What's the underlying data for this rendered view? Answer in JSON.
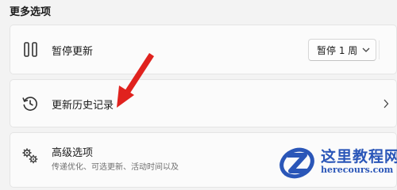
{
  "section": {
    "title": "更多选项"
  },
  "pause_card": {
    "label": "暂停更新",
    "icon": "pause-icon",
    "dropdown_value": "暂停 1 周"
  },
  "history_card": {
    "label": "更新历史记录",
    "icon": "history-icon"
  },
  "advanced_card": {
    "label": "高级选项",
    "description": "传递优化、可选更新、活动时间以及",
    "icon": "gears-icon"
  },
  "annotation": {
    "arrow_color": "#e0221e"
  },
  "watermark": {
    "title": "这里教程网",
    "url": "herecours.com"
  }
}
